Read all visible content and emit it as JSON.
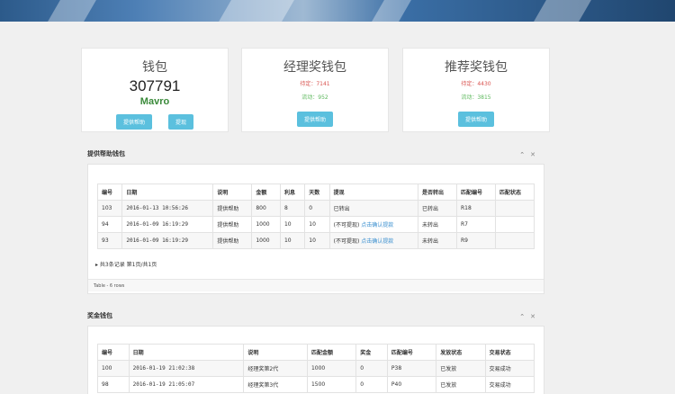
{
  "cards": {
    "wallet": {
      "title": "钱包",
      "amount": "307791",
      "currency": "Mavro",
      "btn_help": "提供帮助",
      "btn_withdraw": "提现"
    },
    "manager": {
      "title": "经理奖钱包",
      "pending": "待定：7141",
      "flow": "流动：952",
      "btn_help": "提供帮助"
    },
    "referral": {
      "title": "推荐奖钱包",
      "pending": "待定：4430",
      "flow": "流动：3815",
      "btn_help": "提供帮助"
    }
  },
  "help_panel": {
    "title": "提供帮助钱包",
    "headers": [
      "编号",
      "日期",
      "说明",
      "金额",
      "利息",
      "天数",
      "提现",
      "是否转出",
      "匹配编号",
      "匹配状态"
    ],
    "rows": [
      {
        "id": "103",
        "date": "2016-01-13 10:56:26",
        "desc": "提供帮助",
        "amount": "800",
        "interest": "8",
        "days": "0",
        "withdraw": "已转出",
        "withdraw_link": "",
        "out": "已转出",
        "match_no": "R18",
        "match_status": ""
      },
      {
        "id": "94",
        "date": "2016-01-09 16:19:29",
        "desc": "提供帮助",
        "amount": "1000",
        "interest": "10",
        "days": "10",
        "withdraw": "(不可提现)",
        "withdraw_link": "点击确认提款",
        "out": "未转出",
        "match_no": "R7",
        "match_status": ""
      },
      {
        "id": "93",
        "date": "2016-01-09 16:19:29",
        "desc": "提供帮助",
        "amount": "1000",
        "interest": "10",
        "days": "10",
        "withdraw": "(不可提现)",
        "withdraw_link": "点击确认提款",
        "out": "未转出",
        "match_no": "R9",
        "match_status": ""
      }
    ],
    "records": "共3条记录 第1页/共1页",
    "footer": "Table - 6 rows"
  },
  "bonus_panel": {
    "title": "奖金钱包",
    "headers": [
      "编号",
      "日期",
      "说明",
      "匹配金额",
      "奖金",
      "匹配编号",
      "发放状态",
      "交易状态"
    ],
    "rows": [
      {
        "id": "100",
        "date": "2016-01-19 21:02:38",
        "desc": "经理奖第2代",
        "amount": "1000",
        "bonus": "0",
        "match_no": "P38",
        "issue": "已发放",
        "trade": "交易成功"
      },
      {
        "id": "98",
        "date": "2016-01-19 21:05:07",
        "desc": "经理奖第3代",
        "amount": "1500",
        "bonus": "0",
        "match_no": "P40",
        "issue": "已发放",
        "trade": "交易成功"
      }
    ]
  },
  "icons": {
    "collapse": "chevron-up-icon",
    "close": "close-icon"
  }
}
